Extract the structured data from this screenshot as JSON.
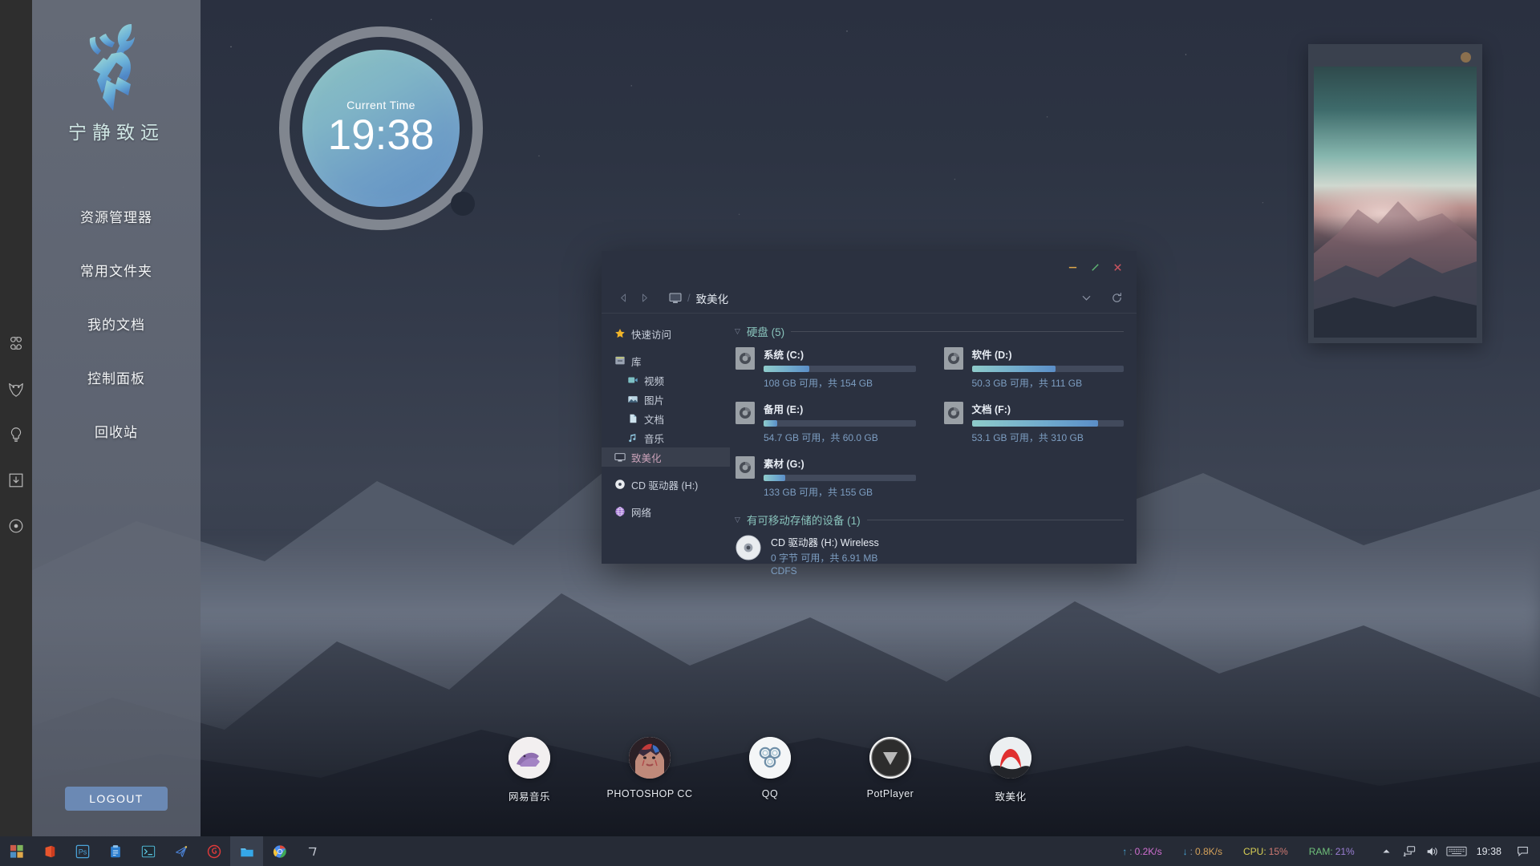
{
  "desktop": {
    "rail_icons": [
      {
        "name": "apps-grid-icon",
        "label": "Apps"
      },
      {
        "name": "fox-icon",
        "label": "Fox"
      },
      {
        "name": "lightbulb-icon",
        "label": "Ideas"
      },
      {
        "name": "download-box-icon",
        "label": "Downloads"
      },
      {
        "name": "record-circle-icon",
        "label": "Record"
      }
    ]
  },
  "left_panel": {
    "logo_name": "deer-logo",
    "motto": "宁静致远",
    "items": [
      {
        "label": "资源管理器"
      },
      {
        "label": "常用文件夹"
      },
      {
        "label": "我的文档"
      },
      {
        "label": "控制面板"
      },
      {
        "label": "回收站"
      }
    ],
    "logout_label": "LOGOUT"
  },
  "clock_widget": {
    "label": "Current Time",
    "time": "19:38"
  },
  "photo_widget": {
    "caption": ""
  },
  "explorer": {
    "titlebar": {
      "minimize": "–",
      "maximize": "⟋",
      "close": "✕"
    },
    "nav": {
      "back": "◁",
      "forward": "▷",
      "crumb_root_icon": "this-pc-icon",
      "crumb_separator": "/",
      "crumb_text": "致美化",
      "dropdown": "⌄",
      "refresh": "↻"
    },
    "sidebar": [
      {
        "label": "快速访问",
        "icon": "star-icon",
        "indent": false,
        "selected": false
      },
      {
        "label": "库",
        "icon": "library-icon",
        "indent": false,
        "selected": false
      },
      {
        "label": "视频",
        "icon": "video-icon",
        "indent": true,
        "selected": false
      },
      {
        "label": "图片",
        "icon": "picture-icon",
        "indent": true,
        "selected": false
      },
      {
        "label": "文档",
        "icon": "document-icon",
        "indent": true,
        "selected": false
      },
      {
        "label": "音乐",
        "icon": "music-icon",
        "indent": true,
        "selected": false
      },
      {
        "label": "致美化",
        "icon": "this-pc-icon",
        "indent": false,
        "selected": true
      },
      {
        "label": "CD 驱动器 (H:)",
        "icon": "cd-drive-icon",
        "indent": false,
        "selected": false
      },
      {
        "label": "网络",
        "icon": "network-icon",
        "indent": false,
        "selected": false
      }
    ],
    "groups": {
      "hard_disks": {
        "title": "硬盘 (5)",
        "caret": "▽",
        "drives": [
          {
            "name": "系统 (C:)",
            "meta": "108 GB 可用，共 154 GB",
            "used_percent": 30
          },
          {
            "name": "软件 (D:)",
            "meta": "50.3 GB 可用，共 111 GB",
            "used_percent": 55
          },
          {
            "name": "备用 (E:)",
            "meta": "54.7 GB 可用，共 60.0 GB",
            "used_percent": 9
          },
          {
            "name": "文档 (F:)",
            "meta": "53.1 GB 可用，共 310 GB",
            "used_percent": 83
          },
          {
            "name": "素材 (G:)",
            "meta": "133 GB 可用，共 155 GB",
            "used_percent": 14
          }
        ]
      },
      "removable": {
        "title": "有可移动存储的设备 (1)",
        "caret": "▽",
        "devices": [
          {
            "name": "CD 驱动器 (H:) Wireless",
            "meta_line1": "0 字节 可用，共 6.91 MB",
            "meta_line2": "CDFS"
          }
        ]
      }
    }
  },
  "dock": {
    "items": [
      {
        "label": "网易音乐",
        "icon": "netease-music-icon"
      },
      {
        "label": "PHOTOSHOP CC",
        "icon": "photoshop-icon"
      },
      {
        "label": "QQ",
        "icon": "qq-icon"
      },
      {
        "label": "PotPlayer",
        "icon": "potplayer-icon"
      },
      {
        "label": "致美化",
        "icon": "zhimeihua-icon"
      }
    ]
  },
  "taskbar": {
    "left_buttons": [
      {
        "name": "start-button",
        "icon": "windows-logo-icon",
        "active": false
      },
      {
        "name": "office-button",
        "icon": "office-icon",
        "active": false
      },
      {
        "name": "photoshop-button",
        "icon": "photoshop-ps-icon",
        "active": false
      },
      {
        "name": "clipboard-button",
        "icon": "clipboard-icon",
        "active": false
      },
      {
        "name": "terminal-button",
        "icon": "terminal-icon",
        "active": false
      },
      {
        "name": "paperplane-button",
        "icon": "paper-plane-icon",
        "active": false
      },
      {
        "name": "netease-button",
        "icon": "netease-icon",
        "active": false
      },
      {
        "name": "explorer-button",
        "icon": "folder-icon",
        "active": true
      },
      {
        "name": "chrome-button",
        "icon": "chrome-icon",
        "active": false
      },
      {
        "name": "misc-button",
        "icon": "corner-icon",
        "active": false
      }
    ],
    "stats": {
      "upload": {
        "arrow": "↑",
        "sep": ":",
        "value": "0.2K/s",
        "color": "#d06fd0"
      },
      "download": {
        "arrow": "↓",
        "sep": ":",
        "value": "0.8K/s",
        "color": "#d4a15a"
      },
      "cpu": {
        "label": "CPU:",
        "value": "15%",
        "label_color": "#d8cf55",
        "value_color": "#cf7a72"
      },
      "ram": {
        "label": "RAM:",
        "value": "21%",
        "label_color": "#6fc07a",
        "value_color": "#9b7fd4"
      }
    },
    "tray": [
      {
        "name": "show-hidden-icons-button",
        "glyph": "▲"
      },
      {
        "name": "network-icon",
        "glyph": "network"
      },
      {
        "name": "volume-icon",
        "glyph": "volume"
      },
      {
        "name": "keyboard-icon",
        "glyph": "keyboard"
      }
    ],
    "clock": "19:38",
    "action_center_icon": "action-center-icon"
  }
}
